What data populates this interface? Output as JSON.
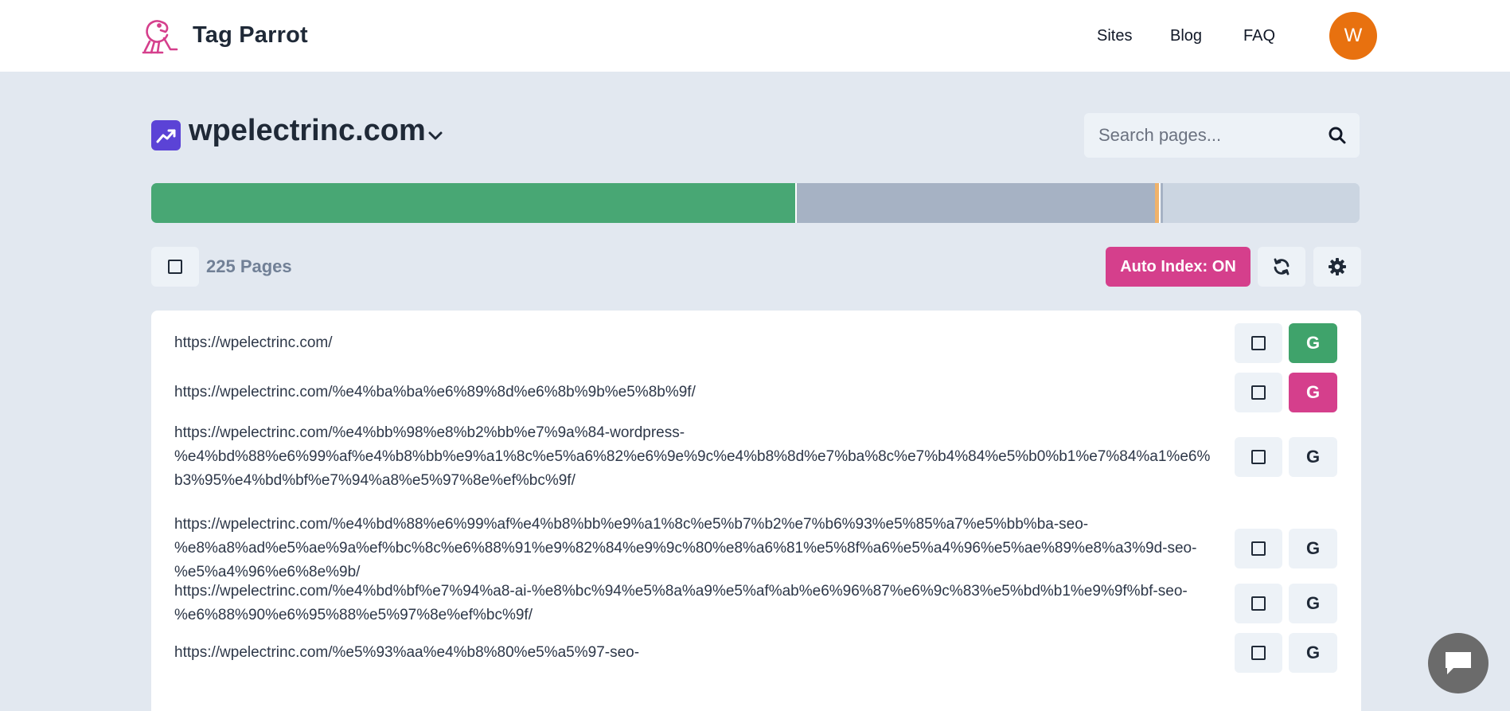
{
  "header": {
    "brand": "Tag Parrot",
    "nav": {
      "sites": "Sites",
      "blog": "Blog",
      "faq": "FAQ"
    },
    "avatar_initial": "W",
    "avatar_color": "#e8710f",
    "brand_color": "#d53f8c"
  },
  "site": {
    "name": "wpelectrinc.com",
    "icon": "trending-up-icon",
    "icon_color": "#5b43d6"
  },
  "search": {
    "placeholder": "Search pages..."
  },
  "status_bar": {
    "segments": [
      {
        "status": "indexed",
        "fraction": 0.533,
        "color": "#48a774"
      },
      {
        "status": "gap",
        "fraction": 0.001,
        "color": "#ffffff"
      },
      {
        "status": "not-indexed",
        "fraction": 0.297,
        "color": "#a6b2c4"
      },
      {
        "status": "submitted",
        "fraction": 0.003,
        "color": "#f0b26a"
      },
      {
        "status": "gap",
        "fraction": 0.001,
        "color": "#ffffff"
      },
      {
        "status": "pending",
        "fraction": 0.002,
        "color": "#a6b2c4"
      },
      {
        "status": "remaining",
        "fraction": 0.163,
        "color": "#cbd5e1"
      }
    ]
  },
  "toolbar": {
    "page_count": "225 Pages",
    "auto_index_label": "Auto Index: ON",
    "auto_index_color": "#d53f8c"
  },
  "pages": [
    {
      "lines": [
        "https://wpelectrinc.com/"
      ],
      "google_status": "indexed",
      "google_label": "G",
      "google_bg": "#3fa36b",
      "google_fg": "#ffffff"
    },
    {
      "lines": [
        "https://wpelectrinc.com/%e4%ba%ba%e6%89%8d%e6%8b%9b%e5%8b%9f/"
      ],
      "google_status": "submitted",
      "google_label": "G",
      "google_bg": "#d53f8c",
      "google_fg": "#ffffff"
    },
    {
      "lines": [
        "https://wpelectrinc.com/%e4%bb%98%e8%b2%bb%e7%9a%84-wordpress-",
        "%e4%bd%88%e6%99%af%e4%b8%bb%e9%a1%8c%e5%a6%82%e6%9e%9c%e4%b8%8d%e7%ba%8c%e7%b4%84%e5%b0%b1%e7%84%a1%e6%",
        "b3%95%e4%bd%bf%e7%94%a8%e5%97%8e%ef%bc%9f/"
      ],
      "google_status": "not-indexed",
      "google_label": "G",
      "google_bg": "#edf2f7",
      "google_fg": "#1f2937"
    },
    {
      "lines": [
        "https://wpelectrinc.com/%e4%bd%88%e6%99%af%e4%b8%bb%e9%a1%8c%e5%b7%b2%e7%b6%93%e5%85%a7%e5%bb%ba-seo-",
        "%e8%a8%ad%e5%ae%9a%ef%bc%8c%e6%88%91%e9%82%84%e9%9c%80%e8%a6%81%e5%8f%a6%e5%a4%96%e5%ae%89%e8%a3%9d-seo-",
        "%e5%a4%96%e6%8e%9b/"
      ],
      "google_status": "not-indexed",
      "google_label": "G",
      "google_bg": "#edf2f7",
      "google_fg": "#1f2937"
    },
    {
      "lines": [
        "https://wpelectrinc.com/%e4%bd%bf%e7%94%a8-ai-%e8%bc%94%e5%8a%a9%e5%af%ab%e6%96%87%e6%9c%83%e5%bd%b1%e9%9f%bf-seo-",
        "%e6%88%90%e6%95%88%e5%97%8e%ef%bc%9f/"
      ],
      "google_status": "not-indexed",
      "google_label": "G",
      "google_bg": "#edf2f7",
      "google_fg": "#1f2937"
    },
    {
      "lines": [
        "https://wpelectrinc.com/%e5%93%aa%e4%b8%80%e5%a5%97-seo-"
      ],
      "google_status": "not-indexed",
      "google_label": "G",
      "google_bg": "#edf2f7",
      "google_fg": "#1f2937"
    }
  ],
  "chat": {
    "icon": "chat-icon"
  }
}
